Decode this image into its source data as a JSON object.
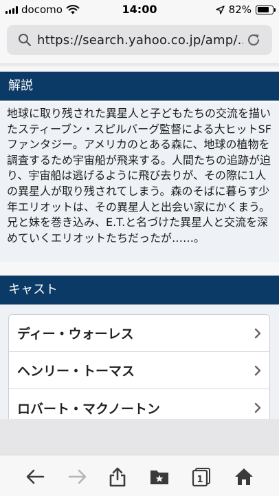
{
  "status_bar": {
    "carrier": "docomo",
    "time": "14:00",
    "battery_percent": "82%",
    "battery_level": 0.82
  },
  "browser": {
    "url": "https://search.yahoo.co.jp/amp/...",
    "icons": [
      "search-icon",
      "reload-icon",
      "back-arrow-icon",
      "forward-arrow-icon",
      "share-icon",
      "bookmarks-icon",
      "tabs-icon",
      "home-icon"
    ],
    "tab_count": "1"
  },
  "synopsis": {
    "header": "解説",
    "text": "地球に取り残された異星人と子どもたちの交流を描いたスティーブン・スピルバーグ監督による大ヒットSFファンタジー。アメリカのとある森に、地球の植物を調査するため宇宙船が飛来する。人間たちの追跡が迫り、宇宙船は逃げるように飛び去りが、その際に1人の異星人が取り残されてしまう。森のそばに暮らす少年エリオットは、その異星人と出会い家にかくまう。兄と妹を巻き込み、E.T.と名づけた異星人と交流を深めていくエリオットたちだったが……。"
  },
  "cast": {
    "header": "キャスト",
    "items": [
      {
        "name": "ディー・ウォーレス"
      },
      {
        "name": "ヘンリー・トーマス"
      },
      {
        "name": "ロバート・マクノートン"
      }
    ]
  },
  "colors": {
    "header_bg": "#0b3a66",
    "content_bg": "#eef1f5",
    "toolbar_icon": "#3a3a3a",
    "disabled_icon": "#b5b5b5"
  }
}
